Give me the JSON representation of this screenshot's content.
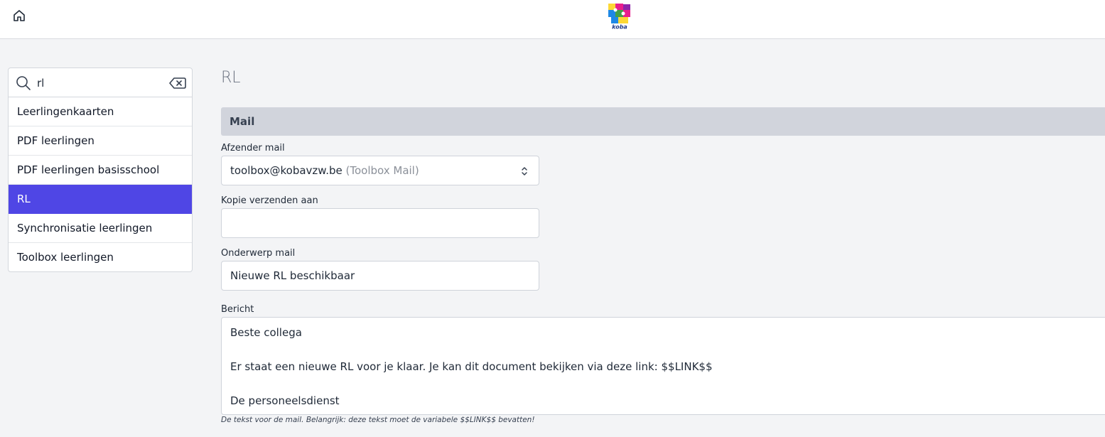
{
  "header": {
    "home_icon": "home-icon",
    "logo_text": "koba",
    "logo_colors": [
      "#e91e8c",
      "#1e88e5",
      "#fdd835",
      "#43a047",
      "#8e24aa"
    ]
  },
  "search": {
    "value": "rl",
    "search_icon": "search-icon",
    "clear_icon": "backspace-icon"
  },
  "results": [
    {
      "label": "Leerlingenkaarten",
      "active": false
    },
    {
      "label": "PDF leerlingen",
      "active": false
    },
    {
      "label": "PDF leerlingen basisschool",
      "active": false
    },
    {
      "label": "RL",
      "active": true
    },
    {
      "label": "Synchronisatie leerlingen",
      "active": false
    },
    {
      "label": "Toolbox leerlingen",
      "active": false
    }
  ],
  "page": {
    "title": "RL",
    "section_title": "Mail"
  },
  "form": {
    "sender": {
      "label": "Afzender mail",
      "value": "toolbox@kobavzw.be",
      "note": "(Toolbox Mail)",
      "icon": "chevron-up-down-icon"
    },
    "cc": {
      "label": "Kopie verzenden aan",
      "value": ""
    },
    "subject": {
      "label": "Onderwerp mail",
      "value": "Nieuwe RL beschikbaar"
    },
    "message": {
      "label": "Bericht",
      "lines": [
        "Beste collega",
        "",
        "Er staat een nieuwe RL voor je klaar. Je kan dit document bekijken via deze link: $$LINK$$",
        "",
        "De personeelsdienst"
      ],
      "help": "De tekst voor de mail. Belangrijk: deze tekst moet de variabele $$LINK$$ bevatten!"
    }
  },
  "theme": {
    "accent": "#4f46e5",
    "background": "#f3f4f6",
    "section_header_bg": "#d1d4dc"
  }
}
